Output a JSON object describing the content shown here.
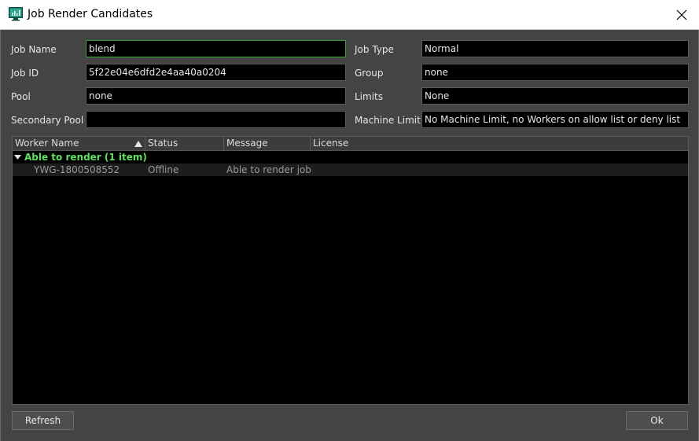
{
  "window": {
    "title": "Job Render Candidates"
  },
  "fields": {
    "job_name": {
      "label": "Job Name",
      "value": "blend"
    },
    "job_id": {
      "label": "Job ID",
      "value": "5f22e04e6dfd2e4aa40a0204"
    },
    "pool": {
      "label": "Pool",
      "value": "none"
    },
    "secondary_pool": {
      "label": "Secondary Pool",
      "value": ""
    },
    "job_type": {
      "label": "Job Type",
      "value": "Normal"
    },
    "group": {
      "label": "Group",
      "value": "none"
    },
    "limits": {
      "label": "Limits",
      "value": "None"
    },
    "machine_limit": {
      "label": "Machine Limit",
      "value": "No Machine Limit, no Workers on allow list or deny list"
    }
  },
  "table": {
    "columns": [
      "Worker Name",
      "Status",
      "Message",
      "License"
    ],
    "group_label": "Able to render (1 item)",
    "rows": [
      {
        "worker": "YWG-1800508552",
        "status": "Offline",
        "message": "Able to render job",
        "license": ""
      }
    ]
  },
  "buttons": {
    "refresh": "Refresh",
    "ok": "Ok"
  },
  "colors": {
    "group_text": "#5ee35e",
    "focus_border": "#3aa03a"
  }
}
